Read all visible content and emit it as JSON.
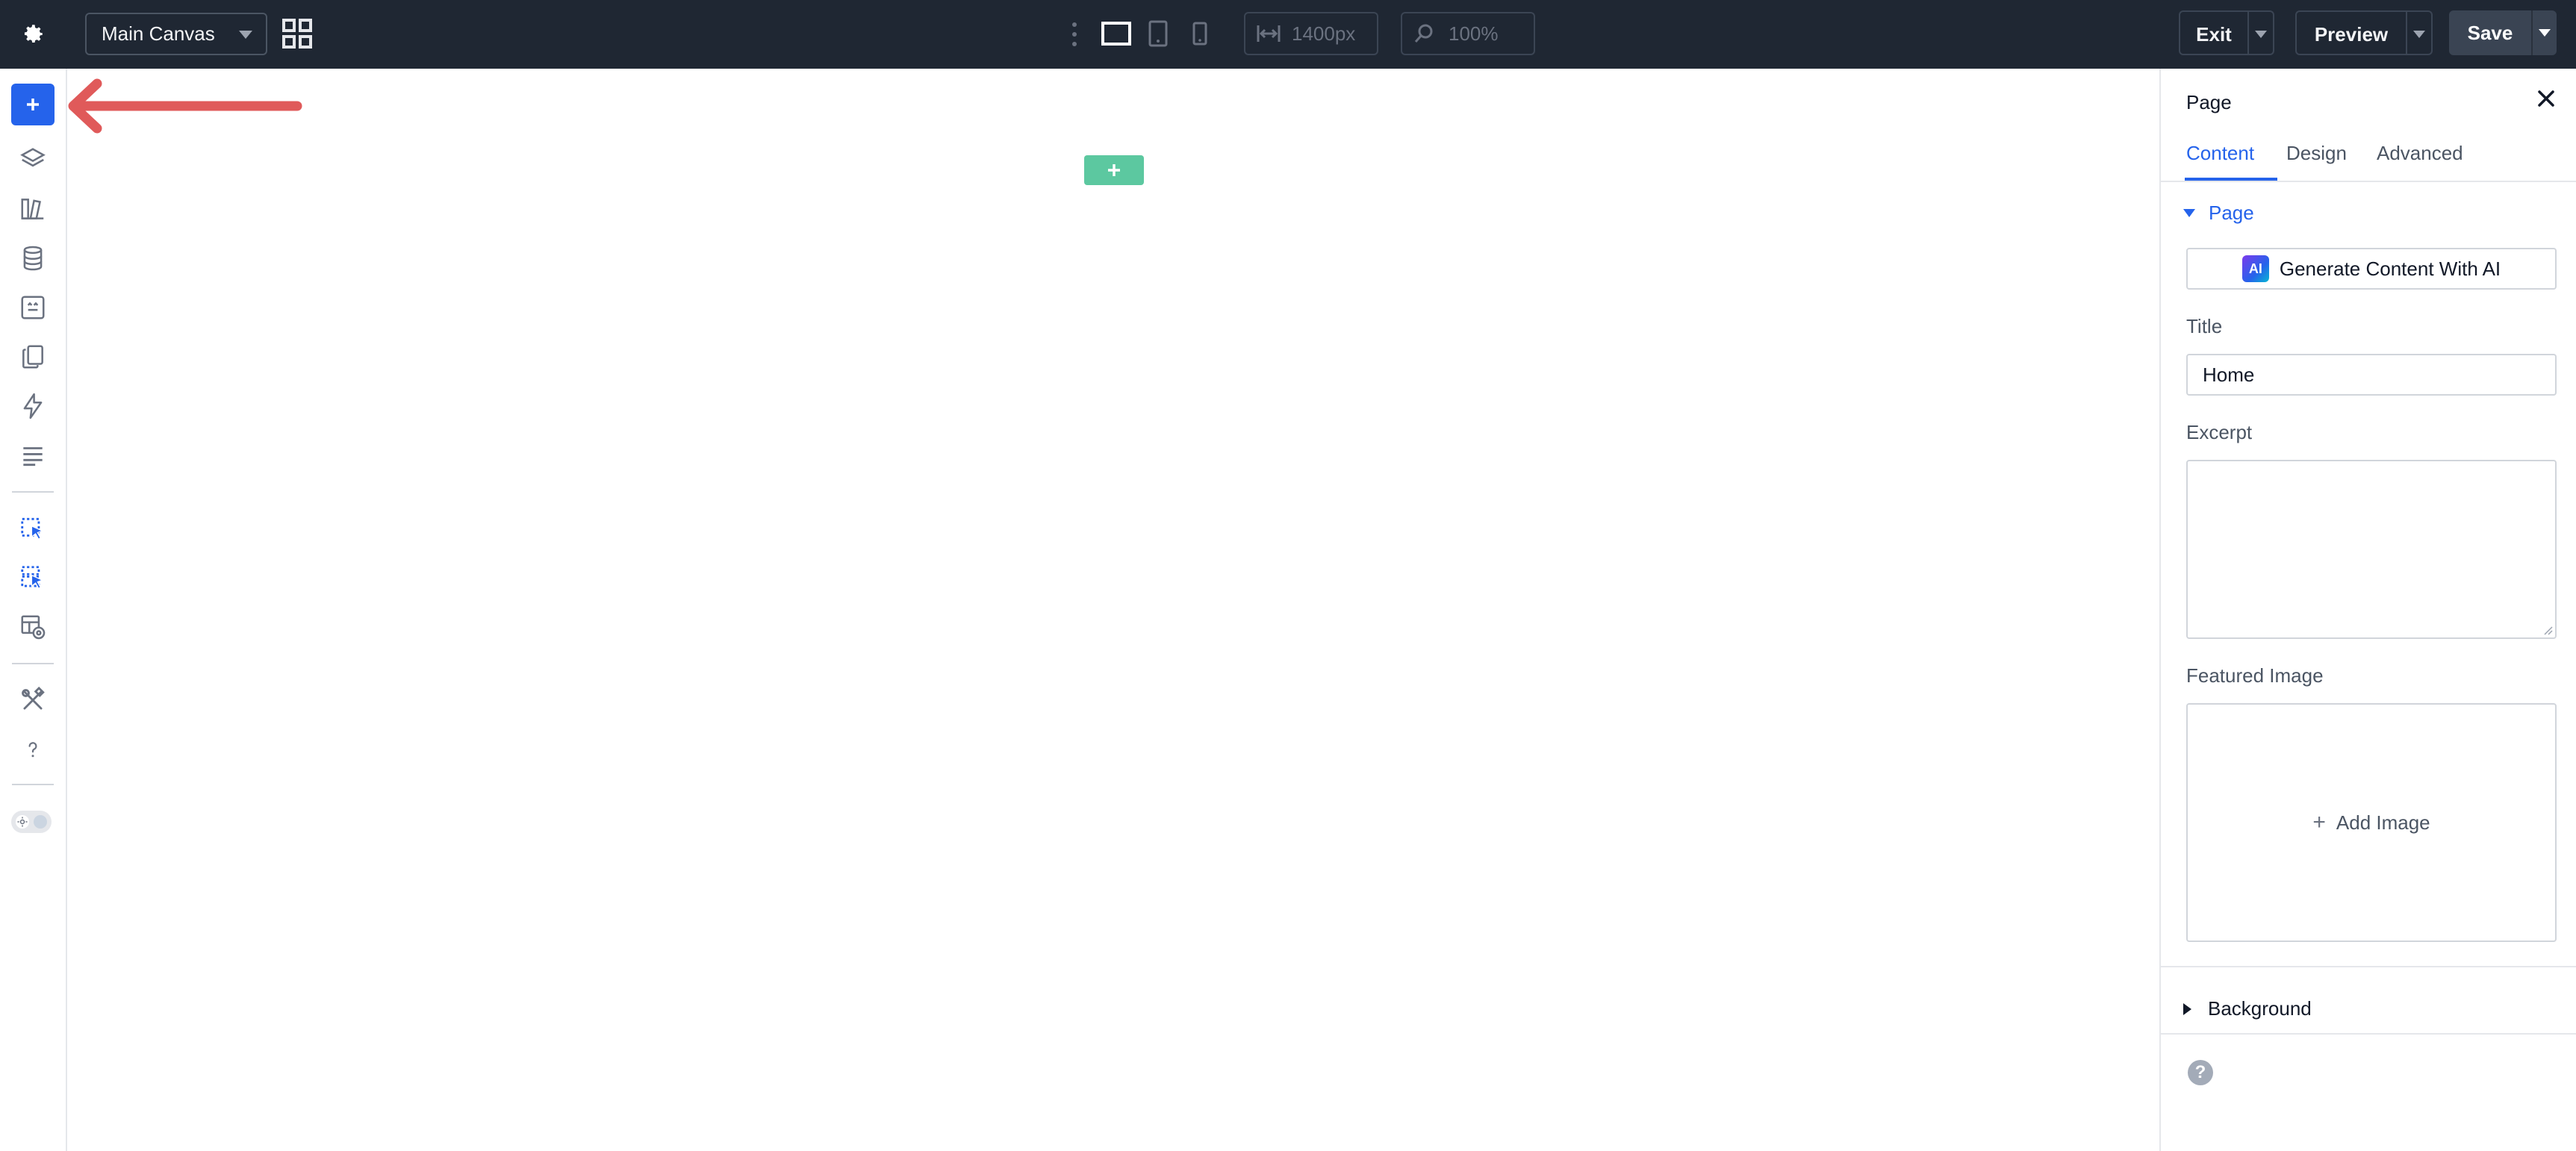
{
  "toolbar": {
    "canvas_select": "Main Canvas",
    "width_value": "1400px",
    "zoom_value": "100%",
    "exit_label": "Exit",
    "preview_label": "Preview",
    "save_label": "Save"
  },
  "sidebar": {
    "icons": [
      "add-icon",
      "layers-icon",
      "library-icon",
      "database-icon",
      "portability-icon",
      "pages-icon",
      "bolt-icon",
      "list-icon",
      "template-cursor-icon",
      "template-cursor-stack-icon",
      "layout-view-icon",
      "tools-icon",
      "help-icon",
      "theme-toggle"
    ]
  },
  "panel": {
    "title": "Page",
    "tabs": [
      "Content",
      "Design",
      "Advanced"
    ],
    "active_tab": "Content",
    "page_section": "Page",
    "ai_button": "Generate Content With AI",
    "ai_badge": "AI",
    "title_label": "Title",
    "title_value": "Home",
    "excerpt_label": "Excerpt",
    "excerpt_value": "",
    "featured_image_label": "Featured Image",
    "add_image": "Add Image",
    "background_section": "Background",
    "help": "?"
  },
  "colors": {
    "topbar": "#1f2733",
    "accent_blue": "#2563eb",
    "add_section_green": "#5cc8a0",
    "annotation_red": "#e05a5a"
  }
}
